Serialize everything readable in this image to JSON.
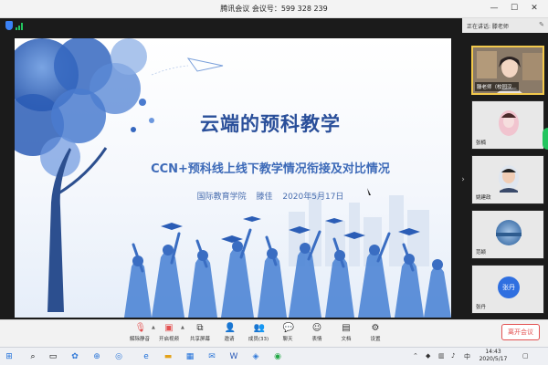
{
  "window": {
    "title": "腾讯会议 会议号：599 328 239",
    "minimize": "—",
    "maximize": "☐",
    "close": "✕"
  },
  "speaker": {
    "label": "正在讲话: 滕老师",
    "pin": "✎"
  },
  "slide": {
    "title": "云端的预科教学",
    "subtitle": "CCN+预科线上线下教学情况衔接及对比情况",
    "org": "国际教育学院",
    "presenter": "滕佳",
    "date": "2020年5月17日"
  },
  "participants": [
    {
      "name": "滕老师（校园汉..."
    },
    {
      "name": "张楠"
    },
    {
      "name": "姚建政"
    },
    {
      "name": "范颖"
    },
    {
      "name": "张丹"
    }
  ],
  "toolbar": {
    "items": [
      {
        "label": "解除静音",
        "icon": "mic-muted-icon"
      },
      {
        "label": "开启视频",
        "icon": "camera-off-icon"
      },
      {
        "label": "共享屏幕",
        "icon": "share-screen-icon"
      },
      {
        "label": "邀请",
        "icon": "invite-icon"
      },
      {
        "label": "成员(33)",
        "icon": "members-icon"
      },
      {
        "label": "聊天",
        "icon": "chat-icon"
      },
      {
        "label": "表情",
        "icon": "emoji-icon"
      },
      {
        "label": "文档",
        "icon": "document-icon"
      },
      {
        "label": "设置",
        "icon": "settings-icon"
      }
    ],
    "leave": "离开会议"
  },
  "taskbar": {
    "time": "14:43",
    "date": "2020/5/17"
  },
  "colors": {
    "slide_title": "#2a4f9a",
    "leave": "#e35151",
    "active_speaker": "#f2c94c"
  }
}
